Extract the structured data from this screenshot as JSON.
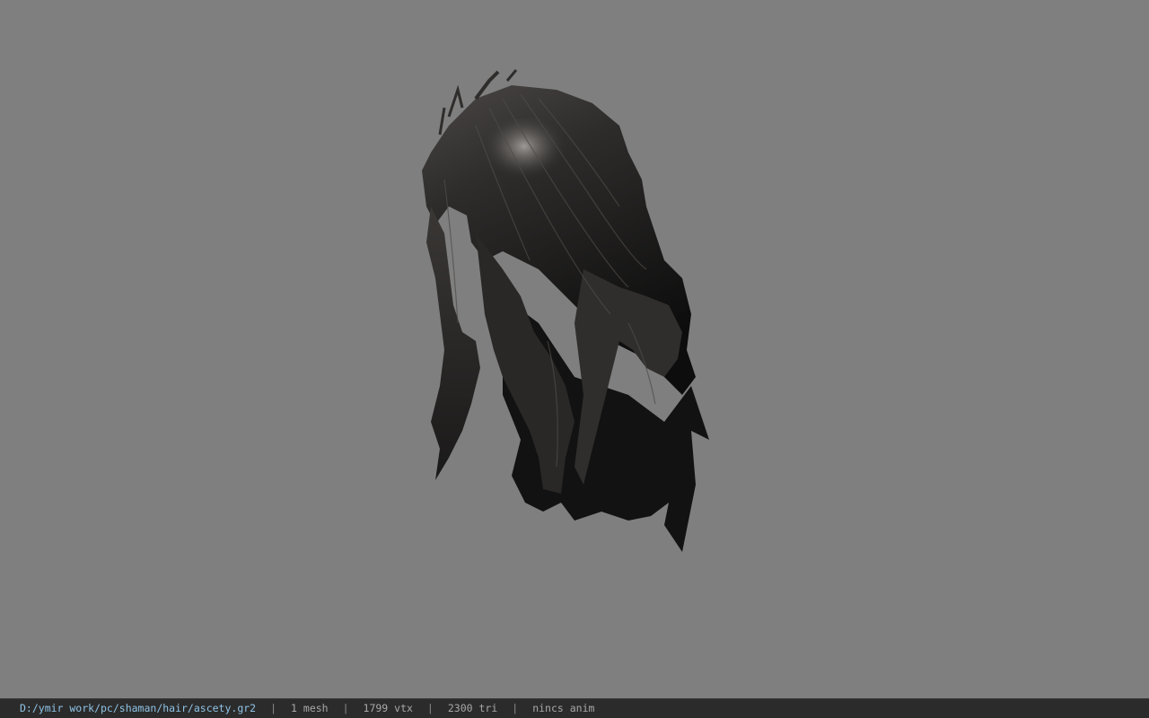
{
  "viewer": {
    "background_color": "#7f7f7f",
    "model_colors": {
      "dark": "#111111",
      "mid": "#2c2a29",
      "light": "#5a5754",
      "highlight": "#9a9794"
    }
  },
  "status_bar": {
    "file_path": "D:/ymir work/pc/shaman/hair/ascety.gr2",
    "separator": "|",
    "mesh_count": "1 mesh",
    "vertex_count": "1799 vtx",
    "triangle_count": "2300 tri",
    "animation_status": "nincs anim"
  }
}
